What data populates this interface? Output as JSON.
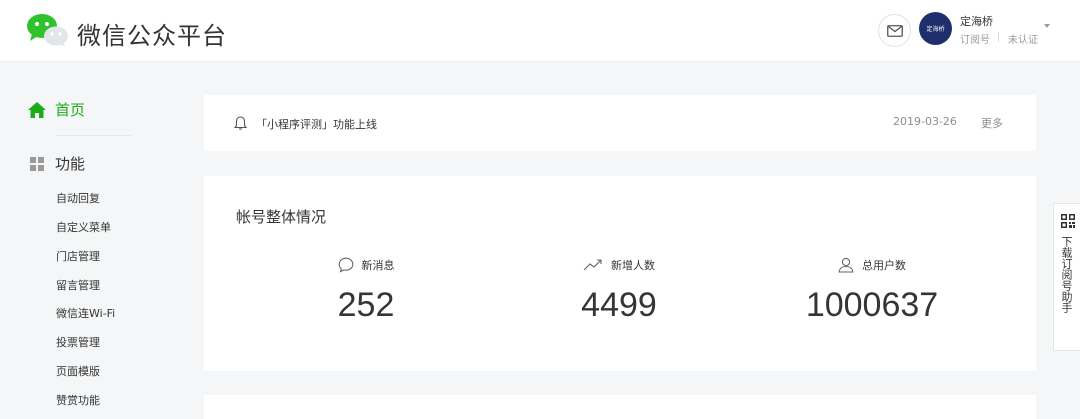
{
  "header": {
    "brand": "微信公众平台",
    "account": {
      "name": "定海桥",
      "type": "订阅号",
      "status": "未认证",
      "avatar_text": "定海桥"
    }
  },
  "sidebar": {
    "home_label": "首页",
    "function_label": "功能",
    "sub_items": [
      "自动回复",
      "自定义菜单",
      "门店管理",
      "留言管理",
      "微信连Wi-Fi",
      "投票管理",
      "页面模版",
      "赞赏功能"
    ]
  },
  "notice": {
    "text": "「小程序评测」功能上线",
    "date": "2019-03-26",
    "more": "更多"
  },
  "stats": {
    "title": "帐号整体情况",
    "items": [
      {
        "label": "新消息",
        "value": "252",
        "icon": "message-bubble-icon"
      },
      {
        "label": "新增人数",
        "value": "4499",
        "icon": "trend-up-icon"
      },
      {
        "label": "总用户数",
        "value": "1000637",
        "icon": "user-icon"
      }
    ]
  },
  "assistant": {
    "label": "下载订阅号助手"
  },
  "colors": {
    "accent": "#1aad19",
    "background": "#f5f6f7"
  }
}
